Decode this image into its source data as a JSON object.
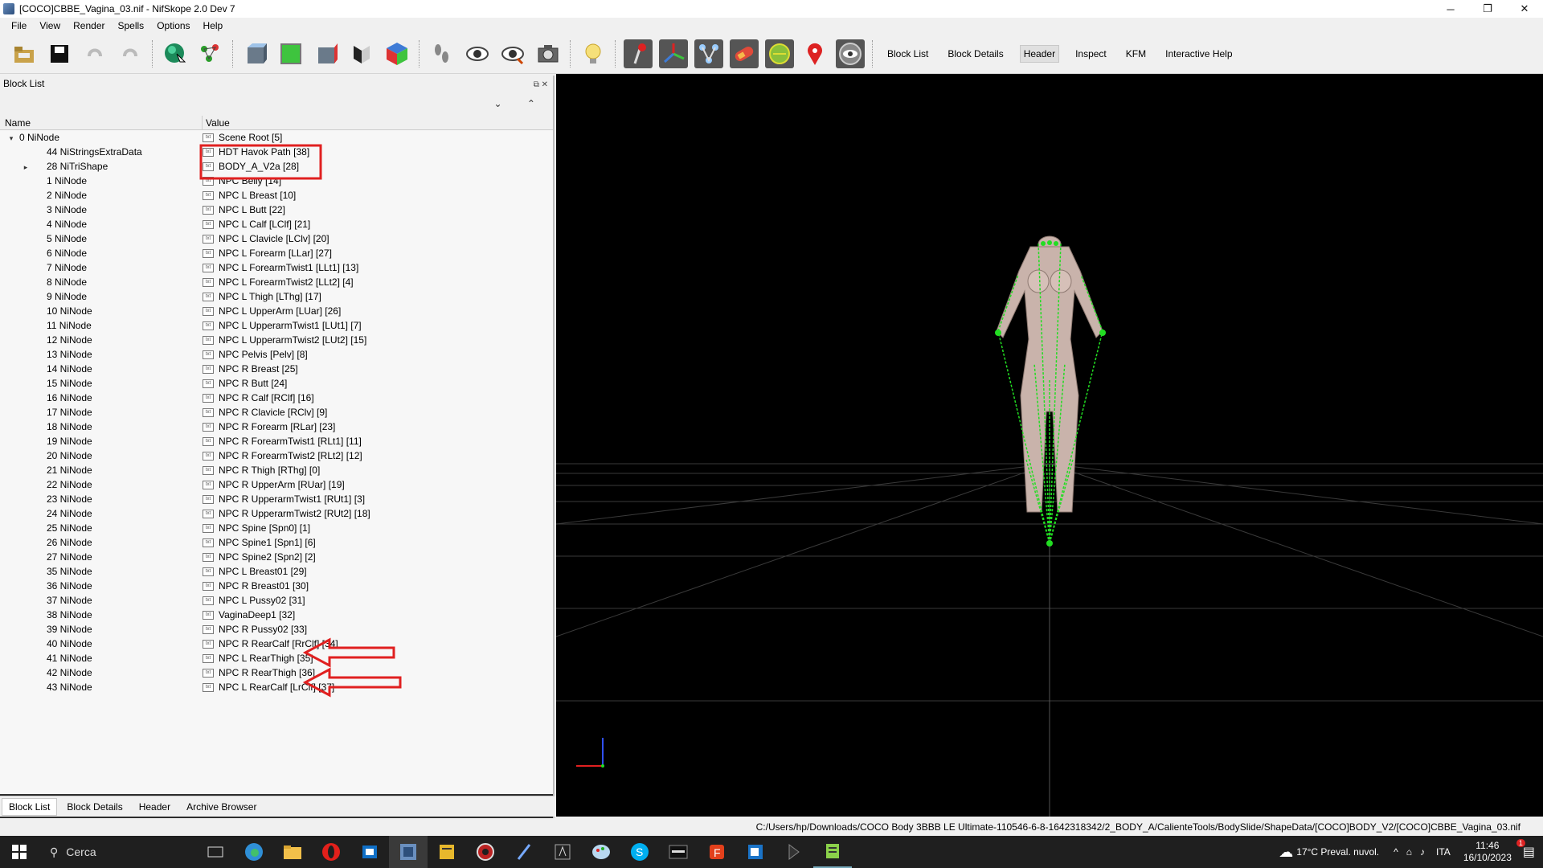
{
  "window": {
    "title": "[COCO]CBBE_Vagina_03.nif - NifSkope 2.0 Dev 7",
    "minimize": "─",
    "restore": "❐",
    "close": "✕"
  },
  "menu": [
    "File",
    "View",
    "Render",
    "Spells",
    "Options",
    "Help"
  ],
  "toolbar": {
    "tabs": [
      {
        "label": "Block List",
        "active": false
      },
      {
        "label": "Block Details",
        "active": false
      },
      {
        "label": "Header",
        "active": true
      },
      {
        "label": "Inspect",
        "active": false
      },
      {
        "label": "KFM",
        "active": false
      },
      {
        "label": "Interactive Help",
        "active": false
      }
    ]
  },
  "blocklist": {
    "title": "Block List",
    "dock_buttons": "⧉ ✕",
    "sort_buttons": "⌄ ⌃",
    "col_name": "Name",
    "col_value": "Value",
    "rows": [
      {
        "name": "0 NiNode",
        "value": "Scene Root [5]",
        "depth": 0,
        "expander": "▾"
      },
      {
        "name": "44 NiStringsExtraData",
        "value": "HDT Havok Path [38]",
        "depth": 1,
        "expander": ""
      },
      {
        "name": "28 NiTriShape",
        "value": "BODY_A_V2a [28]",
        "depth": 1,
        "expander": "▸"
      },
      {
        "name": "1 NiNode",
        "value": "NPC Belly [14]",
        "depth": 1,
        "expander": ""
      },
      {
        "name": "2 NiNode",
        "value": "NPC L Breast [10]",
        "depth": 1,
        "expander": ""
      },
      {
        "name": "3 NiNode",
        "value": "NPC L Butt [22]",
        "depth": 1,
        "expander": ""
      },
      {
        "name": "4 NiNode",
        "value": "NPC L Calf [LClf] [21]",
        "depth": 1,
        "expander": ""
      },
      {
        "name": "5 NiNode",
        "value": "NPC L Clavicle [LClv] [20]",
        "depth": 1,
        "expander": ""
      },
      {
        "name": "6 NiNode",
        "value": "NPC L Forearm [LLar] [27]",
        "depth": 1,
        "expander": ""
      },
      {
        "name": "7 NiNode",
        "value": "NPC L ForearmTwist1 [LLt1] [13]",
        "depth": 1,
        "expander": ""
      },
      {
        "name": "8 NiNode",
        "value": "NPC L ForearmTwist2 [LLt2] [4]",
        "depth": 1,
        "expander": ""
      },
      {
        "name": "9 NiNode",
        "value": "NPC L Thigh [LThg] [17]",
        "depth": 1,
        "expander": ""
      },
      {
        "name": "10 NiNode",
        "value": "NPC L UpperArm [LUar] [26]",
        "depth": 1,
        "expander": ""
      },
      {
        "name": "11 NiNode",
        "value": "NPC L UpperarmTwist1 [LUt1] [7]",
        "depth": 1,
        "expander": ""
      },
      {
        "name": "12 NiNode",
        "value": "NPC L UpperarmTwist2 [LUt2] [15]",
        "depth": 1,
        "expander": ""
      },
      {
        "name": "13 NiNode",
        "value": "NPC Pelvis [Pelv] [8]",
        "depth": 1,
        "expander": ""
      },
      {
        "name": "14 NiNode",
        "value": "NPC R Breast [25]",
        "depth": 1,
        "expander": ""
      },
      {
        "name": "15 NiNode",
        "value": "NPC R Butt [24]",
        "depth": 1,
        "expander": ""
      },
      {
        "name": "16 NiNode",
        "value": "NPC R Calf [RClf] [16]",
        "depth": 1,
        "expander": ""
      },
      {
        "name": "17 NiNode",
        "value": "NPC R Clavicle [RClv] [9]",
        "depth": 1,
        "expander": ""
      },
      {
        "name": "18 NiNode",
        "value": "NPC R Forearm [RLar] [23]",
        "depth": 1,
        "expander": ""
      },
      {
        "name": "19 NiNode",
        "value": "NPC R ForearmTwist1 [RLt1] [11]",
        "depth": 1,
        "expander": ""
      },
      {
        "name": "20 NiNode",
        "value": "NPC R ForearmTwist2 [RLt2] [12]",
        "depth": 1,
        "expander": ""
      },
      {
        "name": "21 NiNode",
        "value": "NPC R Thigh [RThg] [0]",
        "depth": 1,
        "expander": ""
      },
      {
        "name": "22 NiNode",
        "value": "NPC R UpperArm [RUar] [19]",
        "depth": 1,
        "expander": ""
      },
      {
        "name": "23 NiNode",
        "value": "NPC R UpperarmTwist1 [RUt1] [3]",
        "depth": 1,
        "expander": ""
      },
      {
        "name": "24 NiNode",
        "value": "NPC R UpperarmTwist2 [RUt2] [18]",
        "depth": 1,
        "expander": ""
      },
      {
        "name": "25 NiNode",
        "value": "NPC Spine [Spn0] [1]",
        "depth": 1,
        "expander": ""
      },
      {
        "name": "26 NiNode",
        "value": "NPC Spine1 [Spn1] [6]",
        "depth": 1,
        "expander": ""
      },
      {
        "name": "27 NiNode",
        "value": "NPC Spine2 [Spn2] [2]",
        "depth": 1,
        "expander": ""
      },
      {
        "name": "35 NiNode",
        "value": "NPC L Breast01 [29]",
        "depth": 1,
        "expander": ""
      },
      {
        "name": "36 NiNode",
        "value": "NPC R Breast01 [30]",
        "depth": 1,
        "expander": ""
      },
      {
        "name": "37 NiNode",
        "value": "NPC L Pussy02 [31]",
        "depth": 1,
        "expander": ""
      },
      {
        "name": "38 NiNode",
        "value": "VaginaDeep1 [32]",
        "depth": 1,
        "expander": ""
      },
      {
        "name": "39 NiNode",
        "value": "NPC R Pussy02 [33]",
        "depth": 1,
        "expander": ""
      },
      {
        "name": "40 NiNode",
        "value": "NPC R RearCalf [RrClf] [34]",
        "depth": 1,
        "expander": ""
      },
      {
        "name": "41 NiNode",
        "value": "NPC L RearThigh [35]",
        "depth": 1,
        "expander": ""
      },
      {
        "name": "42 NiNode",
        "value": "NPC R RearThigh [36]",
        "depth": 1,
        "expander": ""
      },
      {
        "name": "43 NiNode",
        "value": "NPC L RearCalf [LrClf] [37]",
        "depth": 1,
        "expander": ""
      }
    ]
  },
  "bottom_tabs": [
    {
      "label": "Block List",
      "active": true
    },
    {
      "label": "Block Details",
      "active": false
    },
    {
      "label": "Header",
      "active": false
    },
    {
      "label": "Archive Browser",
      "active": false
    }
  ],
  "statusbar": {
    "path": "C:/Users/hp/Downloads/COCO Body 3BBB LE Ultimate-110546-6-8-1642318342/2_BODY_A/CalienteTools/BodySlide/ShapeData/[COCO]BODY_V2/[COCO]CBBE_Vagina_03.nif"
  },
  "taskbar": {
    "search_placeholder": "Cerca",
    "weather": "17°C  Preval. nuvol.",
    "language": "ITA",
    "time": "11:46",
    "date": "16/10/2023",
    "notification_badge": "1"
  },
  "colors": {
    "highlight": "#e02020",
    "skeleton": "#22dd22",
    "viewport_bg": "#000000",
    "grid": "#3a3a3a"
  }
}
